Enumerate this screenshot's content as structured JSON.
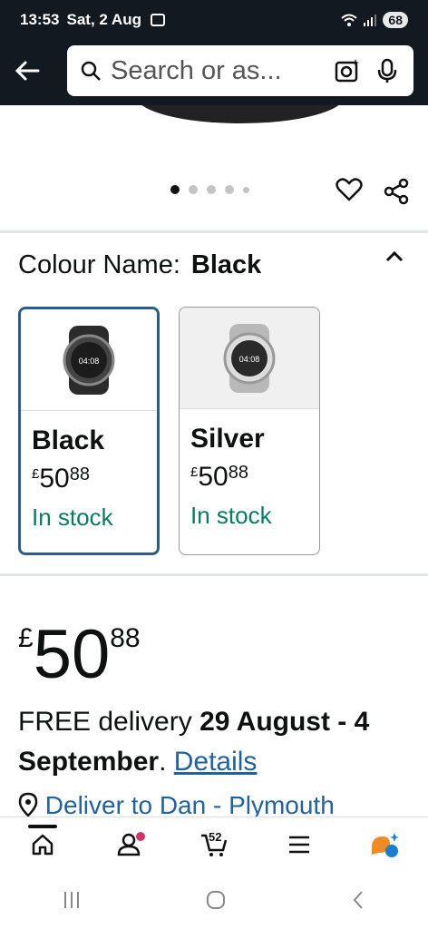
{
  "status": {
    "time": "13:53",
    "date": "Sat, 2 Aug",
    "battery": "68"
  },
  "search": {
    "placeholder": "Search or as..."
  },
  "colour": {
    "label": "Colour Name:",
    "selected": "Black"
  },
  "swatches": [
    {
      "name": "Black",
      "currency": "£",
      "whole": "50",
      "fraction": "88",
      "stock": "In stock"
    },
    {
      "name": "Silver",
      "currency": "£",
      "whole": "50",
      "fraction": "88",
      "stock": "In stock"
    }
  ],
  "watch_face_time": "04:08",
  "price": {
    "currency": "£",
    "whole": "50",
    "fraction": "88"
  },
  "delivery": {
    "prefix": "FREE delivery ",
    "dates": "29 August - 4 September",
    "suffix": ". ",
    "link": "Details"
  },
  "deliver_to": "Deliver to Dan - Plymouth",
  "nav": {
    "cart_count": "52"
  },
  "colors": {
    "header": "#131921",
    "link": "#2162a1",
    "stock": "#067d62",
    "selected_border": "#2a5d8e"
  }
}
